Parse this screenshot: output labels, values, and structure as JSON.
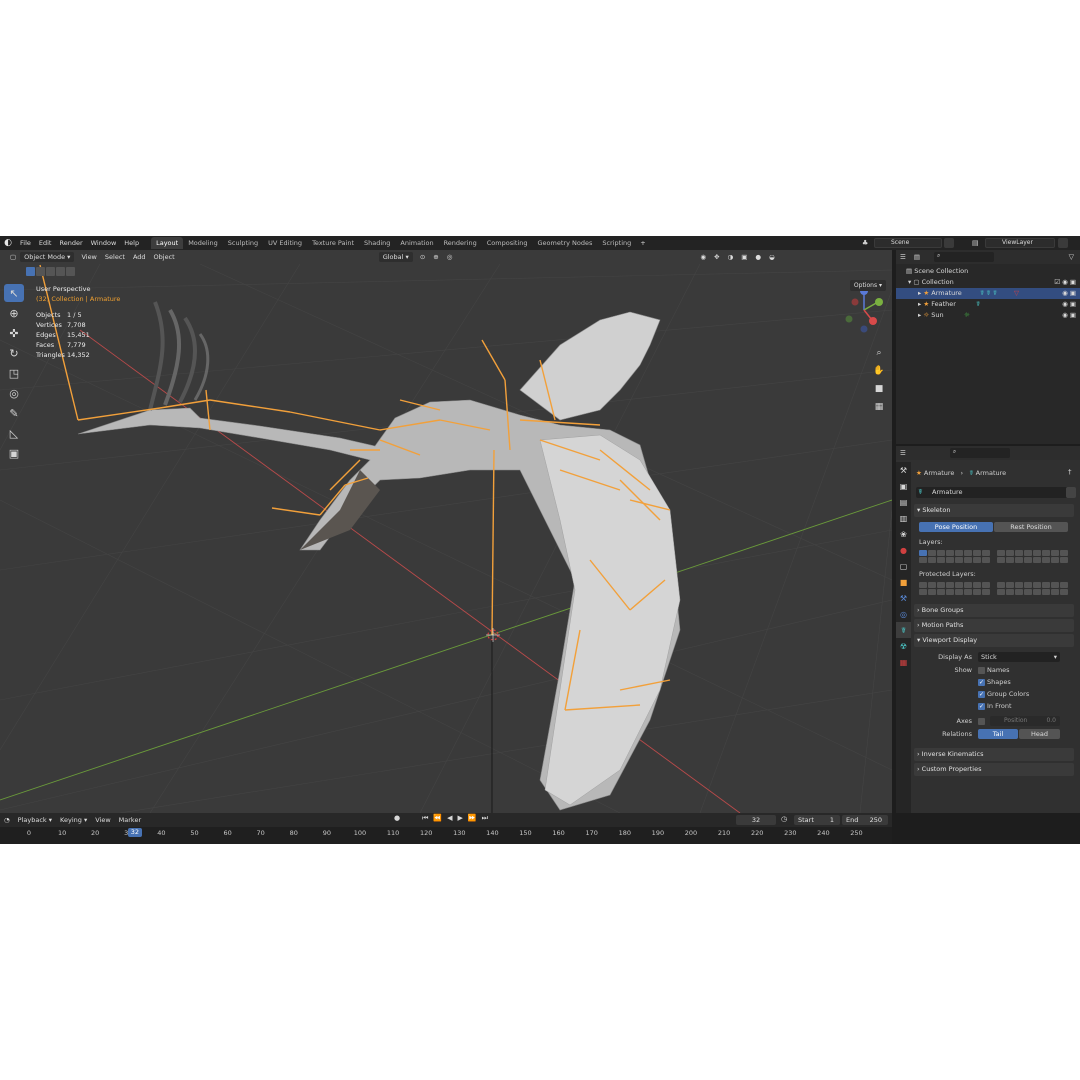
{
  "topbar": {
    "menus": [
      "File",
      "Edit",
      "Render",
      "Window",
      "Help"
    ],
    "workspaces": [
      "Layout",
      "Modeling",
      "Sculpting",
      "UV Editing",
      "Texture Paint",
      "Shading",
      "Animation",
      "Rendering",
      "Compositing",
      "Geometry Nodes",
      "Scripting"
    ],
    "active_workspace": "Layout",
    "scene": "Scene",
    "view_layer": "ViewLayer"
  },
  "viewport": {
    "mode": "Object Mode",
    "menus": [
      "View",
      "Select",
      "Add",
      "Object"
    ],
    "orientation": "Global",
    "options_label": "Options",
    "perspective": "User Perspective",
    "collection_info": "(32) Collection | Armature",
    "stats": [
      {
        "label": "Objects",
        "value": "1 / 5"
      },
      {
        "label": "Vertices",
        "value": "7,708"
      },
      {
        "label": "Edges",
        "value": "15,451"
      },
      {
        "label": "Faces",
        "value": "7,779"
      },
      {
        "label": "Triangles",
        "value": "14,352"
      }
    ]
  },
  "outliner": {
    "scene_collection": "Scene Collection",
    "collection": "Collection",
    "items": [
      "Armature",
      "Feather",
      "Sun"
    ]
  },
  "properties": {
    "breadcrumb_object": "Armature",
    "breadcrumb_data": "Armature",
    "data_name": "Armature",
    "skeleton_title": "Skeleton",
    "pose_position": "Pose Position",
    "rest_position": "Rest Position",
    "layers_label": "Layers:",
    "protected_layers_label": "Protected Layers:",
    "bone_groups": "Bone Groups",
    "motion_paths": "Motion Paths",
    "viewport_display": "Viewport Display",
    "display_as_label": "Display As",
    "display_as_value": "Stick",
    "show_label": "Show",
    "show_names": "Names",
    "show_shapes": "Shapes",
    "show_group_colors": "Group Colors",
    "show_in_front": "In Front",
    "axes_label": "Axes",
    "axes_position": "Position",
    "axes_value": "0.0",
    "relations_label": "Relations",
    "relations_tail": "Tail",
    "relations_head": "Head",
    "inverse_kinematics": "Inverse Kinematics",
    "custom_properties": "Custom Properties"
  },
  "timeline": {
    "menus": [
      "Playback",
      "Keying",
      "View",
      "Marker"
    ],
    "current_frame": "32",
    "start_label": "Start",
    "start_value": "1",
    "end_label": "End",
    "end_value": "250",
    "ticks": [
      "0",
      "10",
      "20",
      "30",
      "40",
      "50",
      "60",
      "70",
      "80",
      "90",
      "100",
      "110",
      "120",
      "130",
      "140",
      "150",
      "160",
      "170",
      "180",
      "190",
      "200",
      "210",
      "220",
      "230",
      "240",
      "250"
    ],
    "current_frame_marker": 32
  },
  "colors": {
    "accent": "#4772b3",
    "bone": "#f2a03a",
    "grid_x": "#b94a4a",
    "grid_y": "#6a9a3a",
    "mesh": "#cfcfcf"
  }
}
